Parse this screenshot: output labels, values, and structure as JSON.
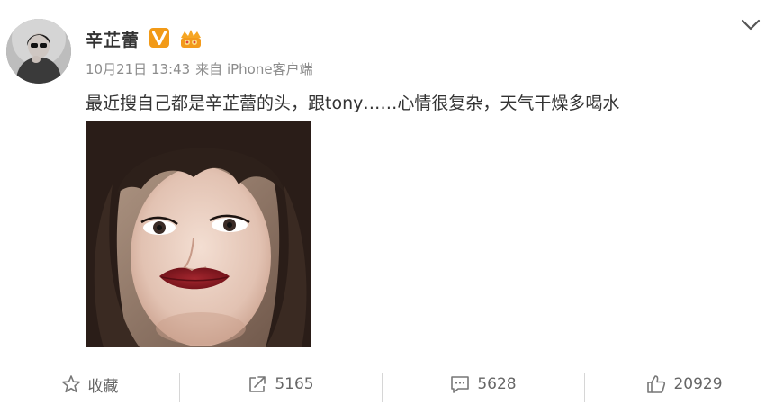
{
  "user": {
    "name": "辛芷蕾"
  },
  "post": {
    "time": "10月21日 13:43",
    "source": "来自 iPhone客户端",
    "text": "最近搜自己都是辛芷蕾的头，跟tony……心情很复杂，天气干燥多喝水"
  },
  "actions": {
    "favorite_label": "收藏",
    "repost_count": "5165",
    "comment_count": "5628",
    "like_count": "20929"
  },
  "colors": {
    "verified_orange": "#f29a17",
    "text_primary": "#333333",
    "text_meta": "#8c8c8c",
    "lip_red": "#8e1a22"
  },
  "icons": {
    "verified": "verified-v-icon",
    "vip": "vip-crown-icon",
    "menu": "chevron-down-icon",
    "favorite": "star-icon",
    "repost": "share-arrow-icon",
    "comment": "comment-bubble-icon",
    "like": "thumbs-up-icon"
  }
}
